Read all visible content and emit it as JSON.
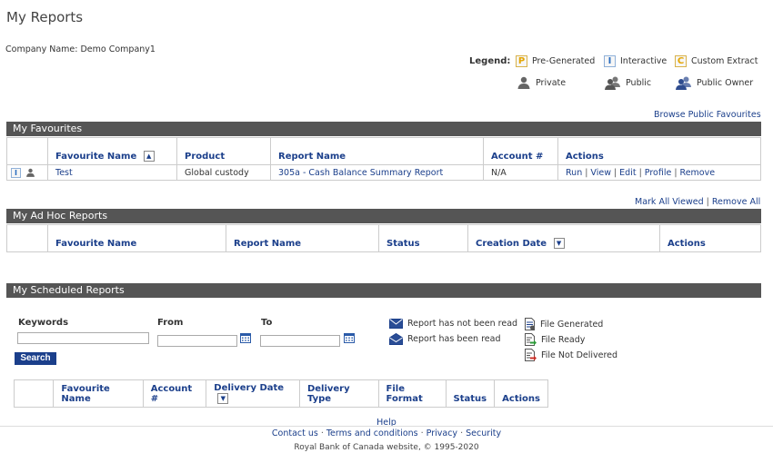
{
  "page": {
    "title": "My Reports",
    "company_label": "Company Name:",
    "company_name": "Demo Company1"
  },
  "legend": {
    "label": "Legend:",
    "items": [
      {
        "letter": "P",
        "label": "Pre-Generated",
        "icon": "pre-generated-icon"
      },
      {
        "letter": "I",
        "label": "Interactive",
        "icon": "interactive-icon"
      },
      {
        "letter": "C",
        "label": "Custom Extract",
        "icon": "custom-extract-icon"
      },
      {
        "label": "Private",
        "icon": "private-user-icon"
      },
      {
        "label": "Public",
        "icon": "public-users-icon"
      },
      {
        "label": "Public Owner",
        "icon": "public-owner-icon"
      }
    ]
  },
  "favourites": {
    "browse_link": "Browse Public Favourites",
    "title": "My Favourites",
    "columns": [
      "Favourite Name",
      "Product",
      "Report Name",
      "Account #",
      "Actions"
    ],
    "rows": [
      {
        "type_letter": "I",
        "name": "Test",
        "product": "Global custody",
        "report": "305a - Cash Balance Summary Report",
        "account": "N/A",
        "actions": [
          "Run",
          "View",
          "Edit",
          "Profile",
          "Remove"
        ]
      }
    ]
  },
  "adhoc": {
    "mark_all_viewed": "Mark All Viewed",
    "remove_all": "Remove All",
    "title": "My Ad Hoc Reports",
    "columns": [
      "Favourite Name",
      "Report Name",
      "Status",
      "Creation Date",
      "Actions"
    ]
  },
  "scheduled": {
    "title": "My Scheduled Reports",
    "keywords_label": "Keywords",
    "from_label": "From",
    "to_label": "To",
    "keywords_value": "",
    "from_value": "",
    "to_value": "",
    "search_label": "Search",
    "status_legend": {
      "not_read": "Report has not been read",
      "read": "Report has been read",
      "generated": "File Generated",
      "ready": "File Ready",
      "not_delivered": "File Not Delivered"
    },
    "columns": [
      "Favourite Name",
      "Account #",
      "Delivery Date",
      "Delivery Type",
      "File Format",
      "Status",
      "Actions"
    ]
  },
  "footer": {
    "help": "Help",
    "links": [
      "Contact us",
      "Terms and conditions",
      "Privacy",
      "Security"
    ],
    "copyright": "Royal Bank of Canada website, © 1995-2020"
  },
  "colors": {
    "link": "#1b3f8b",
    "section_bar": "#555555",
    "legend_gold": "#e5a500",
    "legend_blue": "#2a6dc0",
    "ready_green": "#2e9b3a",
    "not_delivered_red": "#c8322a"
  }
}
